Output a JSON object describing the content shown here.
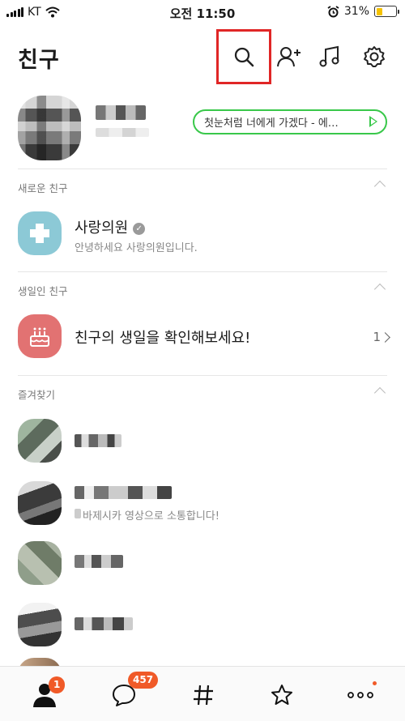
{
  "status_bar": {
    "carrier": "KT",
    "time": "오전 11:50",
    "battery_percent": "31%",
    "battery_level": 0.31
  },
  "header": {
    "title": "친구",
    "icons": [
      "search-icon",
      "add-friend-icon",
      "music-icon",
      "settings-icon"
    ]
  },
  "profile": {
    "music_status": "첫눈처럼 너에게 가겠다 - 에…"
  },
  "sections": {
    "new_friends": {
      "label": "새로운 친구",
      "items": [
        {
          "name": "사랑의원",
          "subtitle": "안녕하세요 사랑의원입니다."
        }
      ]
    },
    "birthday": {
      "label": "생일인 친구",
      "prompt": "친구의 생일을 확인해보세요!",
      "count": "1"
    },
    "favorites": {
      "label": "즐겨찾기",
      "items": [
        {
          "subtitle": ""
        },
        {
          "subtitle": "바제시카 영상으로 소통합니다!"
        },
        {
          "subtitle": ""
        },
        {
          "subtitle": ""
        }
      ]
    }
  },
  "bottom_nav": {
    "friends_badge": "1",
    "chats_badge": "457"
  },
  "colors": {
    "highlight": "#e02626",
    "music_green": "#39c84a",
    "badge": "#f05a28",
    "clinic_icon_bg": "#8cc9d6",
    "birthday_icon_bg": "#e27272"
  }
}
